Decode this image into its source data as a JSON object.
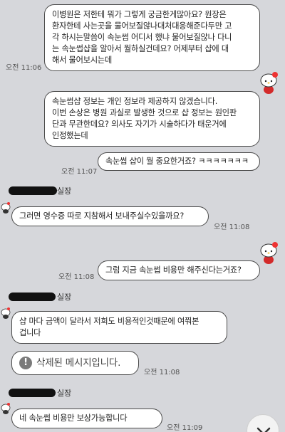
{
  "messages": {
    "m1": {
      "lines": [
        "이병원은 저한테 뭐가 그렇게 궁금한게많아요? 원장은",
        "환자한테 사는곳을 물어보질않나대처대응해준다두만 고",
        "각 하시는말씀이 속눈썹 어디서 했냐 물어보질않나 다니",
        "는 속눈썹샵을 알아서 뭘하실건데요? 어제부터 샵에 대",
        "해서 물어보시는데"
      ],
      "time": "오전 11:06"
    },
    "m2": {
      "lines": [
        "속눈썹샵 정보는 개인 정보라 제공하지 않겠습니다.",
        "이번 손상은 병원 과실로 발생한 것으로 샵 정보는 원인판",
        "단과 무관한데요? 의사도 자기가 시술하다가 태운거에",
        "인정했는데"
      ]
    },
    "m3": {
      "text": "속눈썹 샵이 뭘 중요한거죠? ㅋㅋㅋㅋㅋㅋㅋ",
      "time": "오전 11:07"
    },
    "sender_suffix": "실장",
    "m4": {
      "text": "그러면 영수증 따로 지참해서 보내주실수있을까요?",
      "time": "오전 11:08"
    },
    "m5": {
      "text": "그럼 지금 속눈썹 비용만 해주신다는거죠?",
      "time": "오전 11:08"
    },
    "m6": {
      "lines": [
        "샵 마다 금액이 달라서 저희도 비용적인것때문에 여쭤본",
        "겁니다"
      ]
    },
    "m7": {
      "icon_glyph": "!",
      "text": "삭제된 메시지입니다.",
      "time": "오전 11:08"
    },
    "m8": {
      "text": "네 속눈썹 비용만 보상가능합니다",
      "time": "오전 11:09"
    }
  },
  "colors": {
    "background": "#d6d7db",
    "bubble": "#ffffff",
    "border": "#4a4a4a"
  },
  "icons": {
    "avatar": "hello-kitty-icon",
    "scroll": "chevron-down-icon"
  }
}
